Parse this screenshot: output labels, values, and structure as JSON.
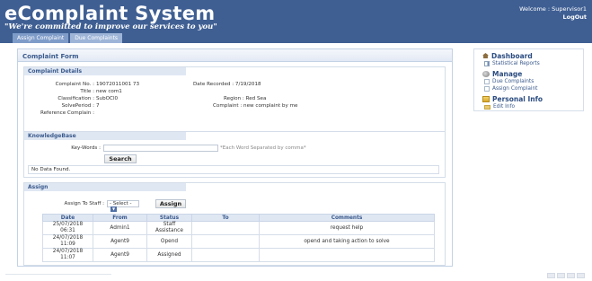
{
  "header": {
    "brand": "eComplaint System",
    "tagline": "\"We're committed to improve our services to you\"",
    "welcome": "Welcome : Supervisor1",
    "logout": "LogOut",
    "tabs": [
      "Assign Complaint",
      "Due Complaints"
    ]
  },
  "form": {
    "title": "Complaint Form",
    "details_heading": "Complaint Details",
    "complaint_no_label": "Complaint No. :",
    "complaint_no": "19072011001 73",
    "date_recorded": "Date Recorded : 7/19/2018",
    "title_label": "Title :",
    "title_value": "new com1",
    "classification_label": "Classification :",
    "classification_value": "SubOCl0",
    "region": "Region : Red Sea",
    "solve_period_label": "SolvePeriod :",
    "solve_period_value": "7",
    "complaint_text": "Complaint : new complaint by me",
    "reference_label": "Reference Complain :"
  },
  "knowledge": {
    "heading": "KnowledgeBase",
    "keywords_label": "Key-Words :",
    "hint": "*Each Word Separated by comma*",
    "search_label": "Search",
    "no_data": "No Data Found."
  },
  "assign": {
    "heading": "Assign",
    "assign_to_label": "Assign To Staff :",
    "select_value": "- Select -",
    "assign_button": "Assign",
    "columns": [
      "Date",
      "From",
      "Status",
      "To",
      "Comments"
    ],
    "rows": [
      {
        "date": "25/07/2018 06:31",
        "from": "Admin1",
        "status": "Staff Assistance",
        "to": "",
        "comments": "request help"
      },
      {
        "date": "24/07/2018 11:09",
        "from": "Agent9",
        "status": "Opend",
        "to": "",
        "comments": "opend and taking action to solve"
      },
      {
        "date": "24/07/2018 11:07",
        "from": "Agent9",
        "status": "Assigned",
        "to": "",
        "comments": ""
      }
    ]
  },
  "sidebar": {
    "dashboard": "Dashboard",
    "statistical_reports": "Statistical Reports",
    "manage": "Manage",
    "due_complaints": "Due Complaints",
    "assign_complaint": "Assign Complaint",
    "personal_info": "Personal Info",
    "edit_info": "Edit Info"
  },
  "colors": {
    "header_bg": "#3f5f93",
    "accent": "#3b5a8c"
  }
}
